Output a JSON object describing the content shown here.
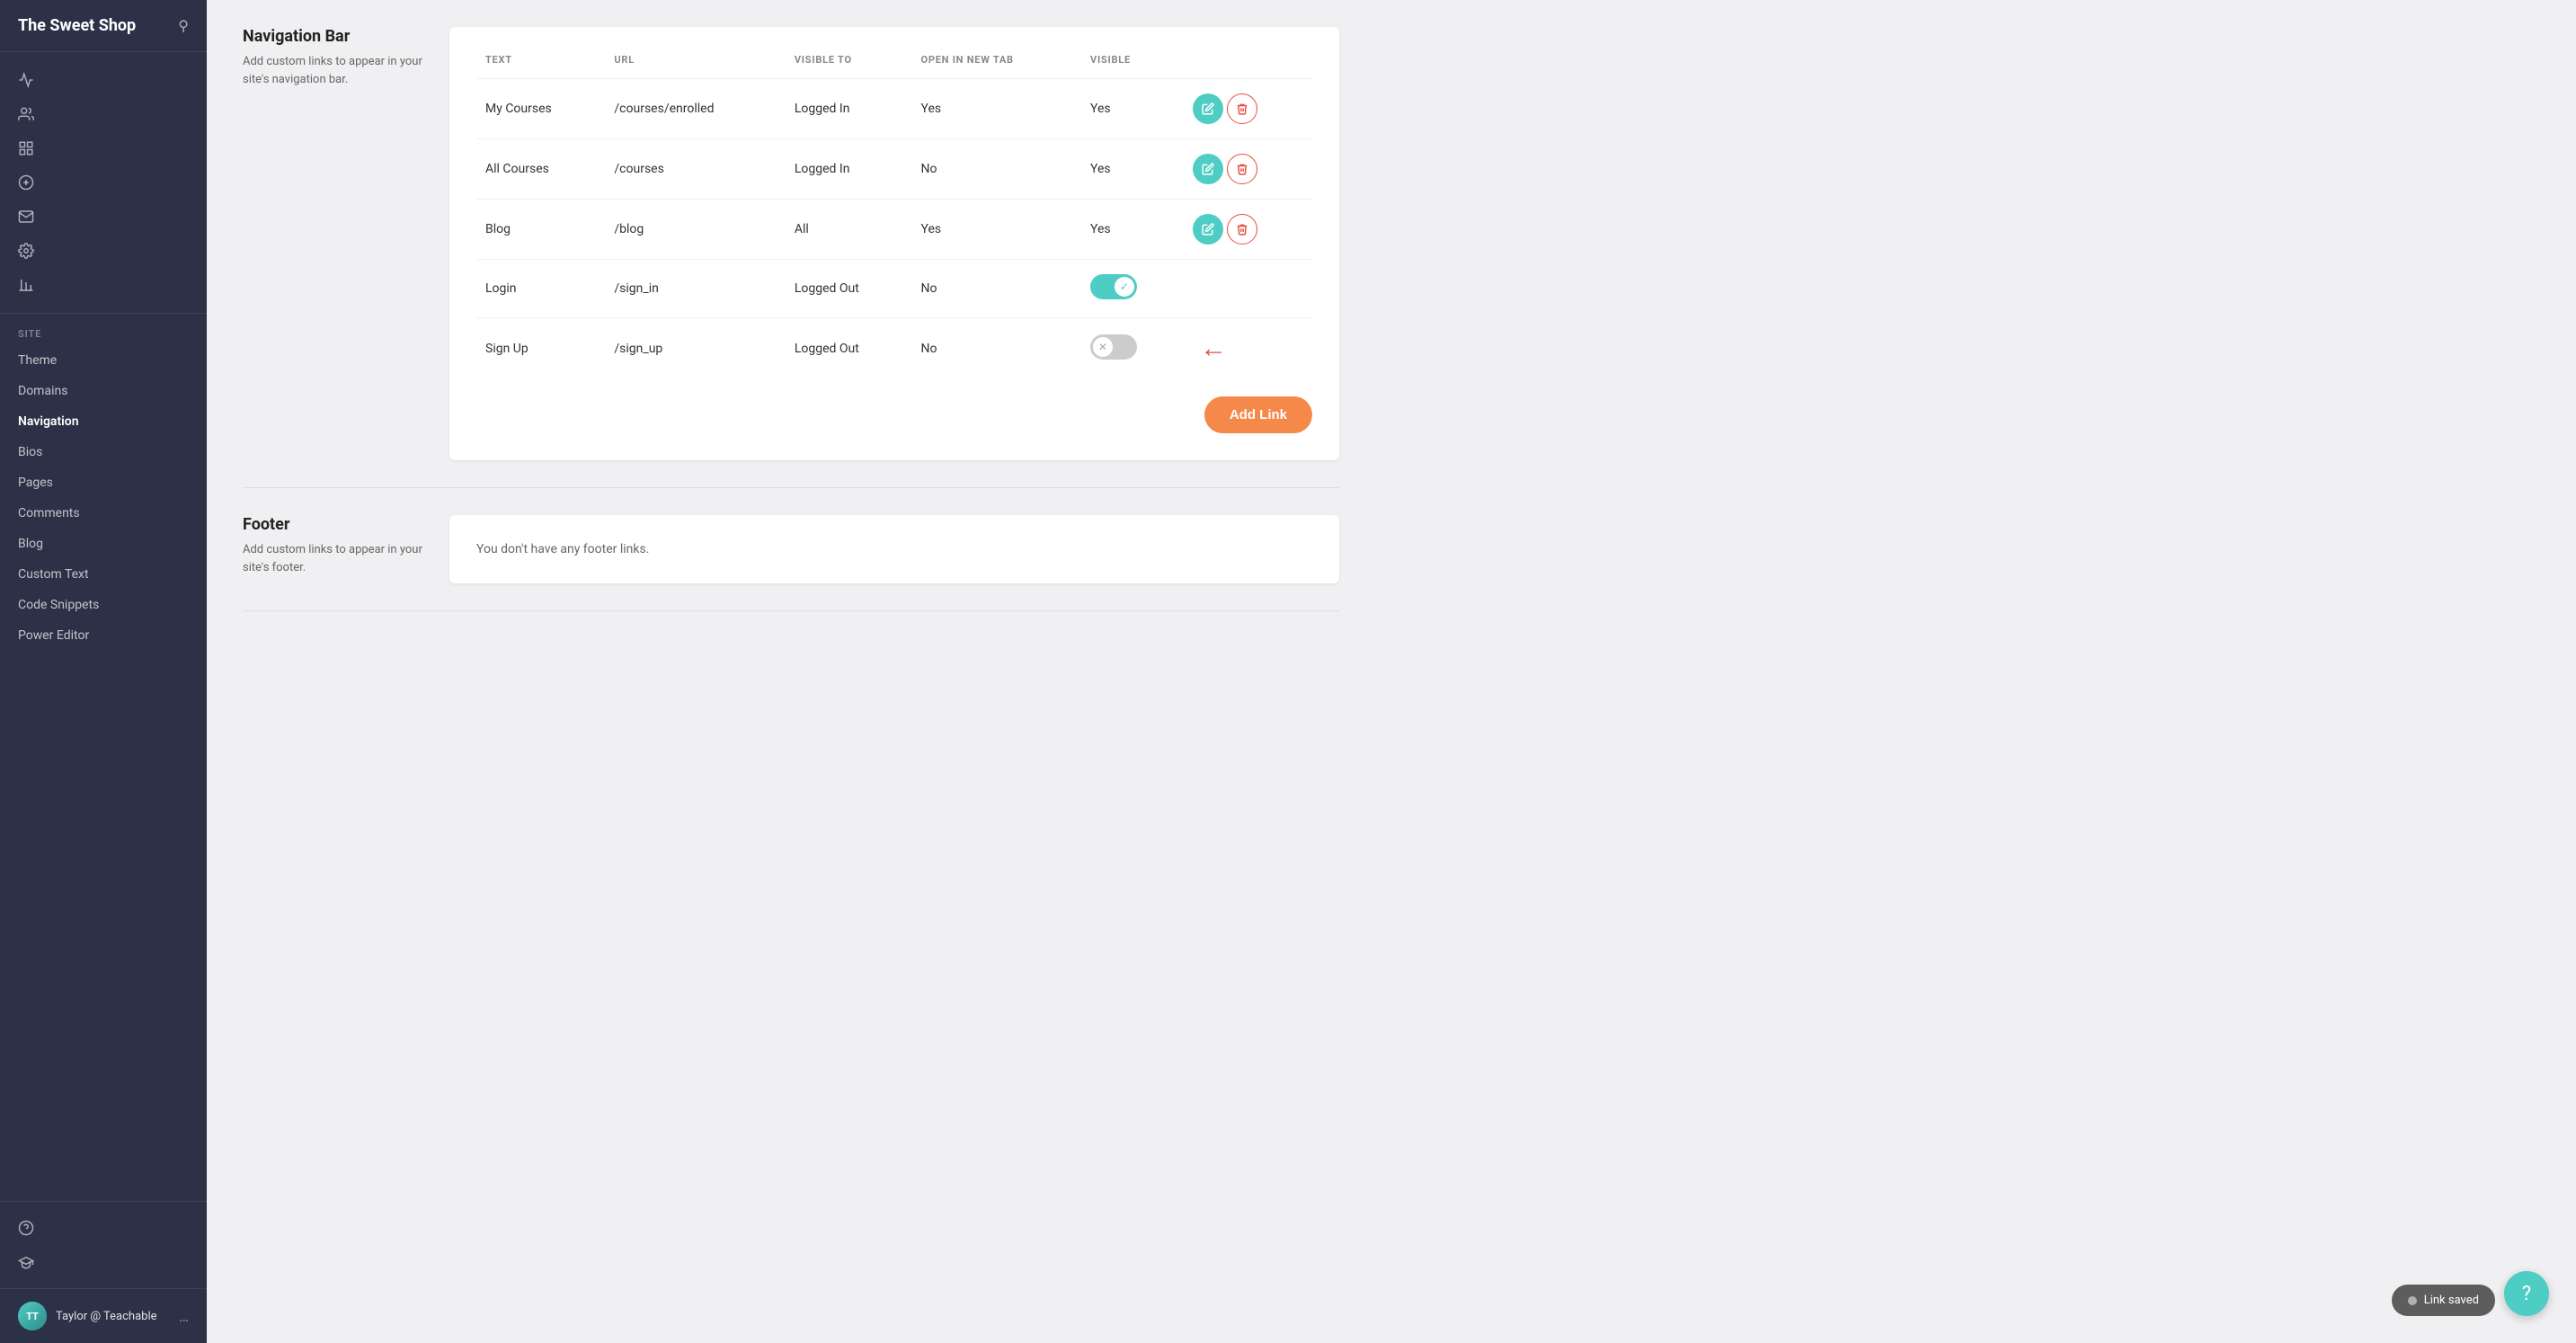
{
  "sidebar": {
    "logo": "The Sweet Shop",
    "search_icon": "🔍",
    "section_label": "SITE",
    "nav_items": [
      {
        "label": "Theme",
        "active": false
      },
      {
        "label": "Domains",
        "active": false
      },
      {
        "label": "Navigation",
        "active": true
      },
      {
        "label": "Bios",
        "active": false
      },
      {
        "label": "Pages",
        "active": false
      },
      {
        "label": "Comments",
        "active": false
      },
      {
        "label": "Blog",
        "active": false
      },
      {
        "label": "Custom Text",
        "active": false
      },
      {
        "label": "Code Snippets",
        "active": false
      },
      {
        "label": "Power Editor",
        "active": false
      }
    ],
    "user_name": "Taylor @ Teachable",
    "user_initials": "TT"
  },
  "nav_bar": {
    "title": "Navigation Bar",
    "description": "Add custom links to appear in your site's navigation bar.",
    "table_headers": [
      "TEXT",
      "URL",
      "VISIBLE TO",
      "OPEN IN NEW TAB",
      "VISIBLE"
    ],
    "rows": [
      {
        "text": "My Courses",
        "url": "/courses/enrolled",
        "visible_to": "Logged In",
        "open_new_tab": "Yes",
        "visible": "Yes",
        "toggle": "none"
      },
      {
        "text": "All Courses",
        "url": "/courses",
        "visible_to": "Logged In",
        "open_new_tab": "No",
        "visible": "Yes",
        "toggle": "none"
      },
      {
        "text": "Blog",
        "url": "/blog",
        "visible_to": "All",
        "open_new_tab": "Yes",
        "visible": "Yes",
        "toggle": "none"
      },
      {
        "text": "Login",
        "url": "/sign_in",
        "visible_to": "Logged Out",
        "open_new_tab": "No",
        "visible": "",
        "toggle": "on"
      },
      {
        "text": "Sign Up",
        "url": "/sign_up",
        "visible_to": "Logged Out",
        "open_new_tab": "No",
        "visible": "",
        "toggle": "off"
      }
    ],
    "add_link_label": "Add Link"
  },
  "footer": {
    "title": "Footer",
    "description": "Add custom links to appear in your site's footer.",
    "no_links_text": "You don't have any footer links."
  },
  "toast": {
    "label": "Link saved"
  },
  "chat": {
    "icon": "?"
  }
}
